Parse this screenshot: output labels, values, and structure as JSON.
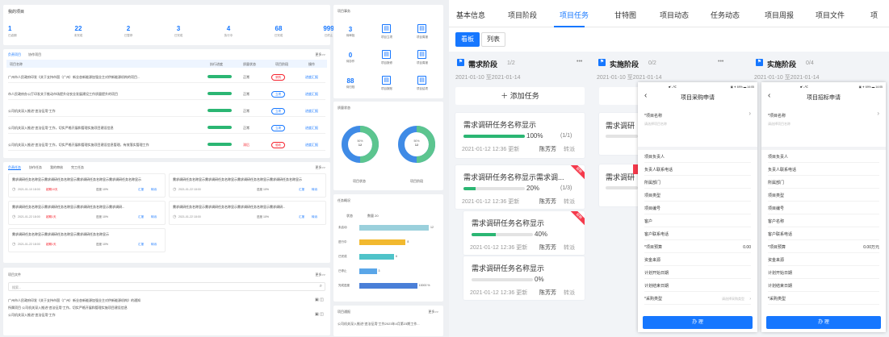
{
  "left": {
    "overview": {
      "title": "我的项目",
      "stats": [
        {
          "value": "1",
          "label": "已逾期"
        },
        {
          "value": "22",
          "label": "未完成"
        },
        {
          "value": "2",
          "label": "已暂停"
        },
        {
          "value": "3",
          "label": "已完成"
        },
        {
          "value": "4",
          "label": "执行中"
        },
        {
          "value": "68",
          "label": "已完成"
        },
        {
          "value": "999",
          "label": "已终止"
        }
      ]
    },
    "projects": {
      "tabs": [
        "负责项目",
        "协作项目"
      ],
      "more": "更多>>",
      "headers": [
        "项目名称",
        "执行进度",
        "质量状态",
        "项目阶段",
        "操作"
      ],
      "rows": [
        {
          "name": "广州市人民政府印发《关于支持市国（广州）新业态新能源加强业主对供新能源机构的项目...",
          "status": "正常",
          "phase": "采购",
          "op": "进度汇报",
          "red": true
        },
        {
          "name": "市人民政府办公厅印发关于推动市场提升化农业发展建设工作质量提升的项目",
          "status": "正常",
          "phase": "立项",
          "op": "进度汇报",
          "red": false
        },
        {
          "name": "公司机关深入推进“违法征用”工作",
          "status": "正常",
          "phase": "立项",
          "op": "进度汇报",
          "red": false
        },
        {
          "name": "公司机关深入推进“违法征用”工作，切实严格开展和管理实施项目建设信息",
          "status": "正常",
          "phase": "立项",
          "op": "进度汇报",
          "red": false
        },
        {
          "name": "公司机关深入推进“违法征用”工作，切实严格开展和管理实施项目建设信息管理，有效落实管理工作",
          "status": "滞后",
          "phase": "验收",
          "op": "进度汇报",
          "red": true
        }
      ]
    },
    "tasks": {
      "tabs": [
        "负责任务",
        "协作任务",
        "我的审核",
        "完工任务"
      ],
      "more": "更多>>",
      "items": [
        {
          "name": "需求调研任务名称显示需求调研任务名称显示需求调研任务名称显示需求调研任务名称显示",
          "date": "2021-01-10 18:00",
          "warn": "超期10天",
          "pct": "进度 10%",
          "a": "汇报",
          "b": "转派"
        },
        {
          "name": "需求调研任务名称显示需求调研任务名称显示需求调研任务名称显示需求调研任务名称显示",
          "date": "2021-01-22 18:00",
          "warn": "",
          "pct": "进度 10%",
          "a": "汇报",
          "b": "转派"
        },
        {
          "name": "需求调研任务名称显示需求调研任务名称显示需求调研任务名称显示需求调研...",
          "date": "2021-01-22 18:00",
          "warn": "超期1天",
          "pct": "进度 10%",
          "a": "汇报",
          "b": "转派"
        },
        {
          "name": "需求调研任务名称显示需求调研任务名称显示需求调研任务名称显示需求调研...",
          "date": "2021-01-22 18:00",
          "warn": "",
          "pct": "进度 10%",
          "a": "汇报",
          "b": "转派"
        },
        {
          "name": "需求调研任务名称显示需求调研任务名称显示需求调研任务名称显示",
          "date": "2021-01-22 18:00",
          "warn": "超期1天",
          "pct": "进度 10%",
          "a": "汇报",
          "b": "转派"
        }
      ]
    },
    "files": {
      "title": "项目文件",
      "more": "更多>>",
      "search": "搜索...",
      "rows": [
        "广州市人民政府印发《关于支持市国（广州）新业态新能源加强业主对供新能源机构》的通知",
        "所属项目 公司机关深入推进“违法征用”工作，切实严格开展和管理实施项目建设信息",
        "公司机关深入推进“违法征用”工作"
      ]
    }
  },
  "mid": {
    "events": {
      "title": "项目事务",
      "items": [
        {
          "num": "3",
          "label": "待审批"
        },
        {
          "label": "项目立项"
        },
        {
          "label": "项目周报"
        },
        {
          "num": "0",
          "label": "待协作"
        },
        {
          "label": "项目报修"
        },
        {
          "label": "项目周报"
        },
        {
          "num": "88",
          "label": "待归档"
        },
        {
          "label": "项目报账"
        },
        {
          "label": "项目结项"
        }
      ]
    },
    "status": {
      "title": "质量状态",
      "pies": [
        {
          "center": "50%",
          "value": "12",
          "label": "项目状态"
        },
        {
          "center": "50%",
          "value": "12",
          "label": "项目阶段"
        }
      ]
    },
    "tasks": {
      "title": "任务概况",
      "header_a": "状态",
      "header_b": "数量 20",
      "more": "",
      "bars": [
        {
          "label": "未启动",
          "value": 12,
          "color": "#9ad0dc"
        },
        {
          "label": "进行中",
          "value": 8,
          "color": "#f2b92f"
        },
        {
          "label": "已完成",
          "value": 6,
          "color": "#4fc3c9"
        },
        {
          "label": "已停止",
          "value": 3,
          "color": "#5aa6e8"
        },
        {
          "label": "完成进度",
          "value": 10,
          "color": "#4a7fd8",
          "text": "10000 %"
        }
      ]
    },
    "news": {
      "title": "项目通报",
      "more": "更多>>",
      "text": "公司机关深入推进“违法征用”工作2023年4月第23期工作..."
    }
  },
  "right": {
    "tabs": [
      "基本信息",
      "项目阶段",
      "项目任务",
      "甘特图",
      "项目动态",
      "任务动态",
      "项目周报",
      "项目文件",
      "项"
    ],
    "active_tab": "项目任务",
    "view": {
      "kanban": "看板",
      "list": "列表"
    },
    "columns": [
      {
        "name": "需求阶段",
        "count": "1/2",
        "range": "2021-01-10 至2021-01-14",
        "add": "＋ 添加任务"
      },
      {
        "name": "实施阶段",
        "count": "0/2",
        "range": "2021-01-10 至2021-01-14"
      },
      {
        "name": "实施阶段",
        "count": "0/4",
        "range": "2021-01-10 至2021-01-14"
      }
    ],
    "cards": [
      {
        "name": "需求调研任务名称显示",
        "pct": "100%",
        "ratio": "(1/1)",
        "date": "2021-01-12  12:36 更新",
        "user": "陈芳芳",
        "act": "转派",
        "fill": 1.0
      },
      {
        "name": "需求调研任务名称显示需求调...",
        "pct": "20%",
        "ratio": "(1/3)",
        "date": "2021-01-12  12:36 更新",
        "user": "陈芳芳",
        "act": "转派",
        "fill": 0.2,
        "badge": "超期"
      },
      {
        "name": "需求调研任务名称显示",
        "pct": "40%",
        "ratio": "",
        "date": "2021-01-12  12:36 更新",
        "user": "陈芳芳",
        "act": "转派",
        "fill": 0.4,
        "badge": "超期"
      },
      {
        "name": "需求调研任务名称显示",
        "pct": "0%",
        "ratio": "",
        "date": "2021-01-12  12:36 更新",
        "user": "陈芳芳",
        "act": "转派",
        "fill": 0
      }
    ],
    "col2": [
      {
        "name": "需求调研"
      },
      {
        "name": "需求调研"
      }
    ],
    "phone1": {
      "status": "■ᵀ.ᵢᵢ℃",
      "time": "▣ ✈ 69% ▬ 14:05",
      "title": "项目采购申请",
      "field1": "项目名称",
      "hint1": "请选择项目名称",
      "fields": [
        "项目负责人",
        "负责人联系电话",
        "所属部门",
        "项目类型",
        "项目编号",
        "客户",
        "客户联系电话",
        "项目预算",
        "资金来源",
        "计划开始日期",
        "计划结束日期",
        "采购类型"
      ],
      "budget": "0.00",
      "select_hint": "请选择采购类型",
      "button": "办 理"
    },
    "phone2": {
      "status": "■ᵀ.ᵢᵢ℃",
      "time": "▣ ✈ 69% ▬ 14:05",
      "title": "项目招标申请",
      "field1": "项目名称",
      "hint1": "请选择项目名称",
      "fields": [
        "项目负责人",
        "负责人联系电话",
        "所属部门",
        "项目类型",
        "项目编号",
        "客户名称",
        "客户联系电话",
        "项目预算",
        "资金来源",
        "计划开始日期",
        "计划结束日期",
        "采购类型"
      ],
      "budget": "0.00万元",
      "button": "办 理"
    }
  }
}
